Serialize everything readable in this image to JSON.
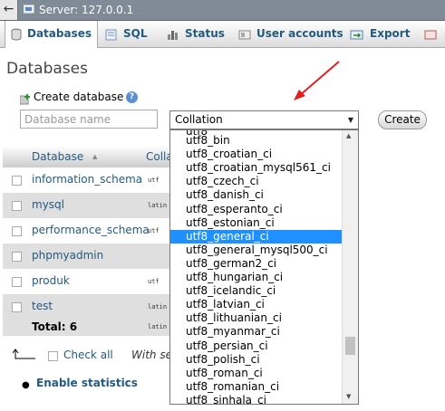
{
  "server": {
    "label": "Server: 127.0.0.1"
  },
  "tabs": [
    {
      "label": "Databases",
      "icon": "databases-icon",
      "active": true
    },
    {
      "label": "SQL",
      "icon": "sql-icon"
    },
    {
      "label": "Status",
      "icon": "status-icon"
    },
    {
      "label": "User accounts",
      "icon": "user-accounts-icon"
    },
    {
      "label": "Export",
      "icon": "export-icon"
    }
  ],
  "page": {
    "title": "Databases"
  },
  "create_db": {
    "label": "Create database",
    "name_placeholder": "Database name",
    "collation_value": "Collation",
    "create_label": "Create"
  },
  "table": {
    "header": {
      "database": "Database",
      "collation": "Colla"
    },
    "rows": [
      {
        "name": "information_schema",
        "collation": "utf"
      },
      {
        "name": "mysql",
        "collation": "latin"
      },
      {
        "name": "performance_schema",
        "collation": "utf"
      },
      {
        "name": "phpmyadmin",
        "collation": ""
      },
      {
        "name": "produk",
        "collation": "utf"
      },
      {
        "name": "test",
        "collation": "latin"
      }
    ],
    "total": {
      "label": "Total: 6",
      "collation": "latin"
    }
  },
  "footer": {
    "check_all": "Check all",
    "with_selected": "With sel",
    "enable_statistics": "Enable statistics"
  },
  "collation_options": {
    "partial_top": "utf8",
    "items": [
      "utf8_bin",
      "utf8_croatian_ci",
      "utf8_croatian_mysql561_ci",
      "utf8_czech_ci",
      "utf8_danish_ci",
      "utf8_esperanto_ci",
      "utf8_estonian_ci",
      "utf8_general_ci",
      "utf8_general_mysql500_ci",
      "utf8_german2_ci",
      "utf8_hungarian_ci",
      "utf8_icelandic_ci",
      "utf8_latvian_ci",
      "utf8_lithuanian_ci",
      "utf8_myanmar_ci",
      "utf8_persian_ci",
      "utf8_polish_ci",
      "utf8_roman_ci",
      "utf8_romanian_ci",
      "utf8_sinhala_ci"
    ],
    "selected_index": 7
  },
  "colors": {
    "link": "#235a81",
    "highlight": "#1e90ff",
    "annotation": "#e02020"
  }
}
